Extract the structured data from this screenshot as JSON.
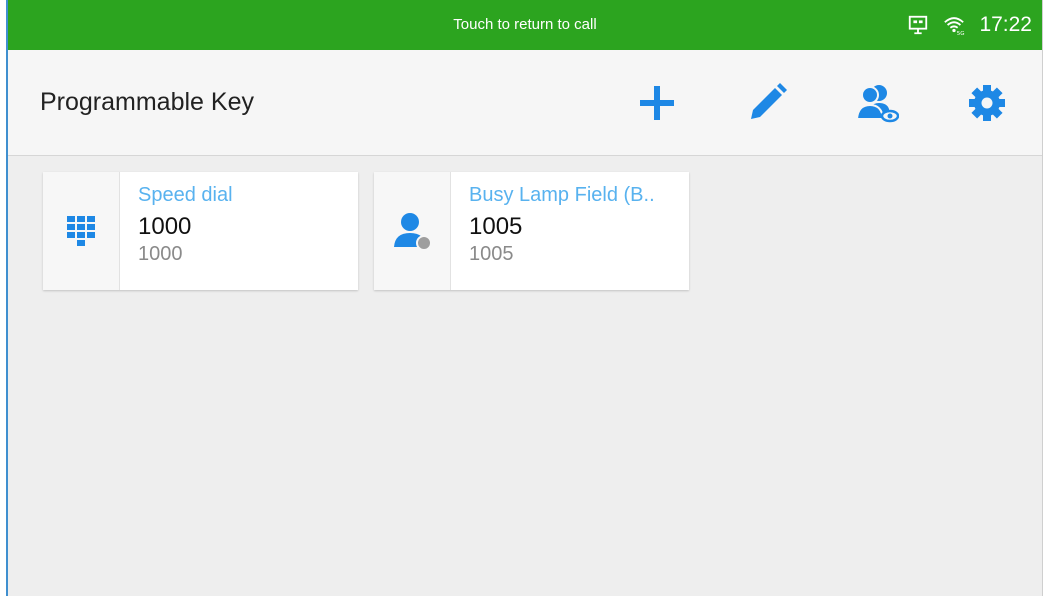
{
  "status_bar": {
    "text": "Touch to return to call",
    "time": "17:22",
    "color": "#2ca41f",
    "icons": [
      "network-icon",
      "wifi-5g-icon"
    ]
  },
  "header": {
    "title": "Programmable Key",
    "actions": [
      {
        "icon": "plus-icon"
      },
      {
        "icon": "pencil-icon"
      },
      {
        "icon": "contacts-view-icon"
      },
      {
        "icon": "gear-icon"
      }
    ],
    "accent_color": "#1e88e5"
  },
  "keys": [
    {
      "icon": "dialpad-icon",
      "type": "Speed dial",
      "name": "1000",
      "number": "1000"
    },
    {
      "icon": "person-status-icon",
      "type": "Busy Lamp Field (B..",
      "name": "1005",
      "number": "1005"
    }
  ]
}
